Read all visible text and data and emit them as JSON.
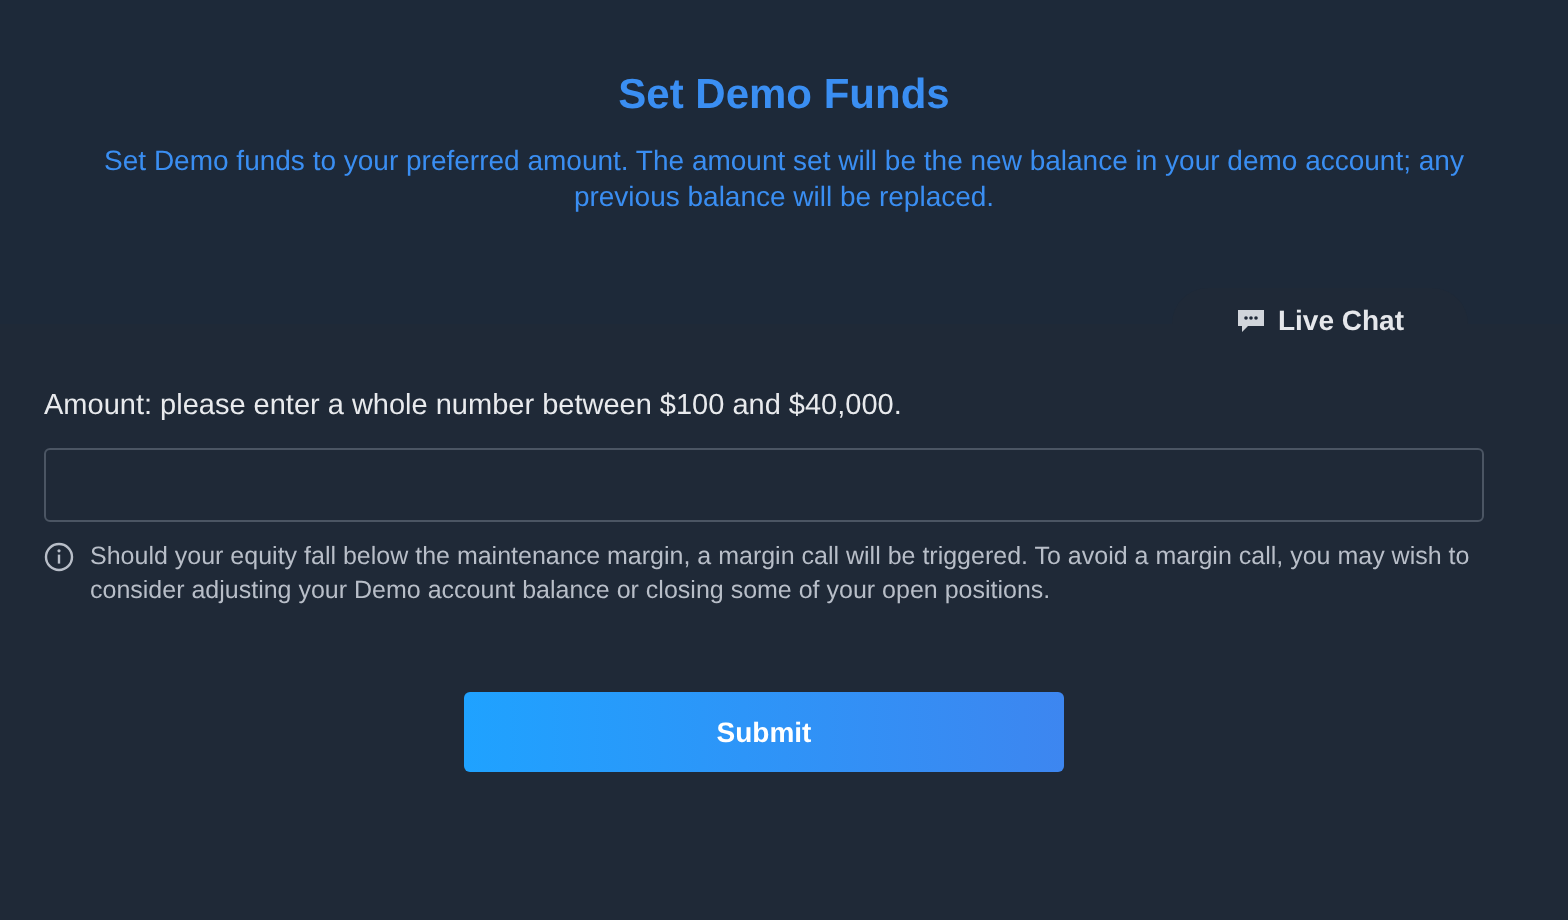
{
  "header": {
    "title": "Set Demo Funds",
    "description": "Set Demo funds to your preferred amount. The amount set will be the new balance in your demo account; any previous balance will be replaced."
  },
  "live_chat": {
    "label": "Live Chat"
  },
  "form": {
    "label": "Amount: please enter a whole number between $100 and $40,000.",
    "note": "Should your equity fall below the maintenance margin, a margin call will be triggered. To avoid a margin call, you may wish to consider adjusting your Demo account balance or closing some of your open positions.",
    "submit": "Submit"
  }
}
